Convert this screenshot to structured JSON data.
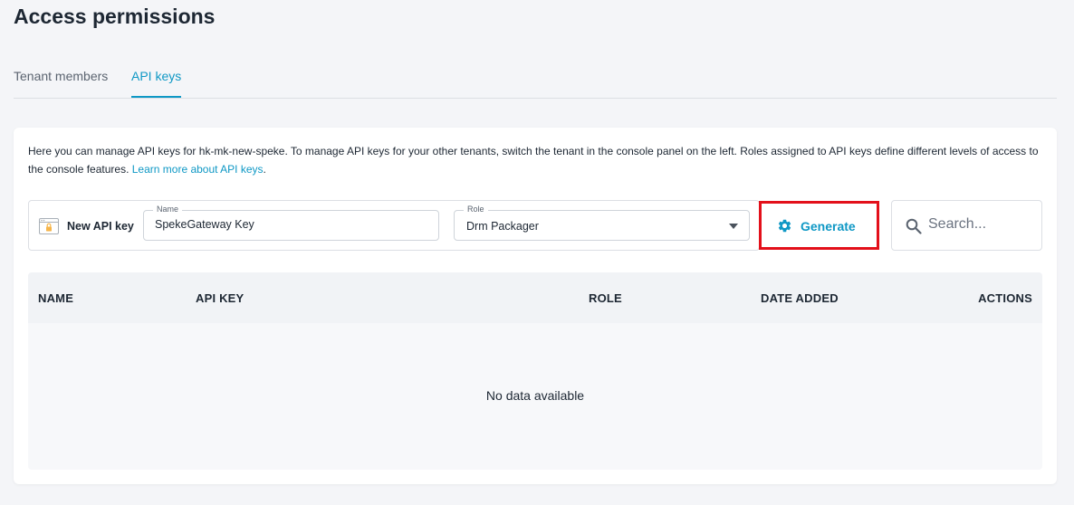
{
  "page": {
    "title": "Access permissions"
  },
  "tabs": [
    {
      "label": "Tenant members",
      "active": false
    },
    {
      "label": "API keys",
      "active": true
    }
  ],
  "intro": {
    "text": "Here you can manage API keys for hk-mk-new-speke. To manage API keys for your other tenants, switch the tenant in the console panel on the left. Roles assigned to API keys define different levels of access to the console features. ",
    "link_text": "Learn more about API keys",
    "trailing": "."
  },
  "new_key": {
    "label": "New API key",
    "icon": "key-window-icon",
    "name_field": {
      "legend": "Name",
      "value": "SpekeGateway Key"
    },
    "role_field": {
      "legend": "Role",
      "value": "Drm Packager"
    }
  },
  "generate": {
    "label": "Generate",
    "icon": "gear-icon",
    "highlight_color": "#e3101a"
  },
  "search": {
    "placeholder": "Search...",
    "value": ""
  },
  "table": {
    "columns": [
      "NAME",
      "API KEY",
      "ROLE",
      "DATE ADDED",
      "ACTIONS"
    ],
    "rows": [],
    "empty_text": "No data available"
  },
  "colors": {
    "accent": "#0f98c5",
    "text": "#1d2733",
    "background": "#f4f5f8"
  }
}
